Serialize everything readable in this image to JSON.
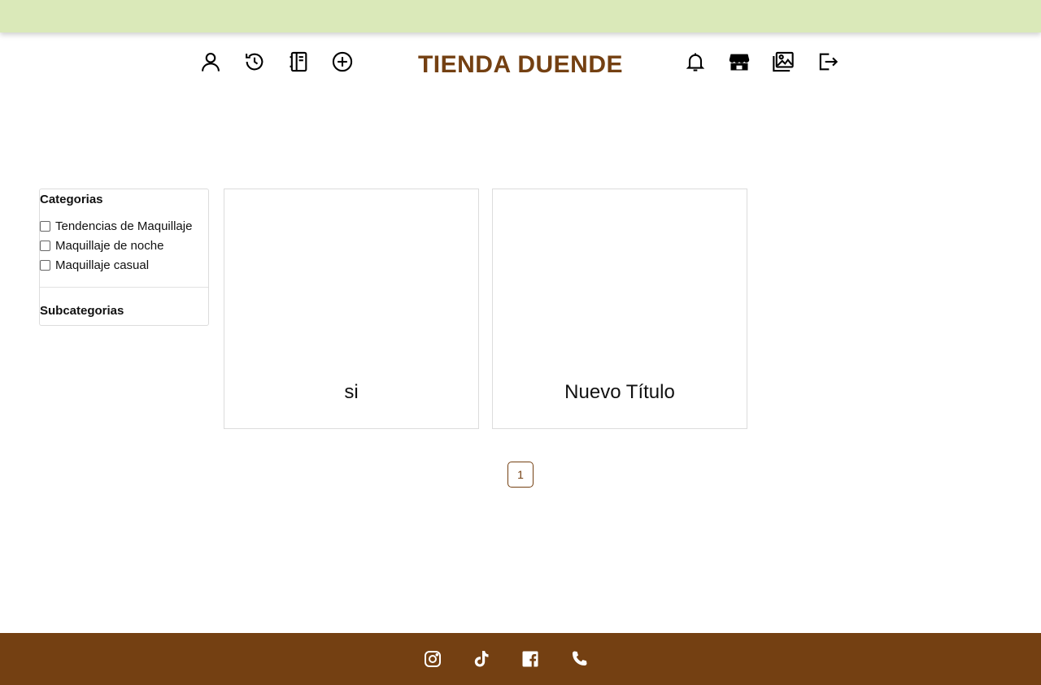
{
  "brand": {
    "name": "TIENDA DUENDE",
    "color": "#744012"
  },
  "colors": {
    "top_bar": "#dae9b9",
    "footer": "#744012",
    "accent": "#744012"
  },
  "header": {
    "left_icons": [
      "user-icon",
      "history-icon",
      "journal-icon",
      "plus-circle-icon"
    ],
    "right_icons": [
      "bell-icon",
      "shop-icon",
      "images-icon",
      "logout-icon"
    ]
  },
  "filters": {
    "categories_title": "Categorias",
    "categories": [
      {
        "label": "Tendencias de Maquillaje",
        "checked": false
      },
      {
        "label": "Maquillaje de noche",
        "checked": false
      },
      {
        "label": "Maquillaje casual",
        "checked": false
      }
    ],
    "subcategories_title": "Subcategorias"
  },
  "cards": [
    {
      "title": "si"
    },
    {
      "title": "Nuevo Título"
    }
  ],
  "pagination": {
    "current": "1"
  },
  "footer": {
    "icons": [
      "instagram-icon",
      "tiktok-icon",
      "facebook-icon",
      "phone-icon"
    ]
  }
}
